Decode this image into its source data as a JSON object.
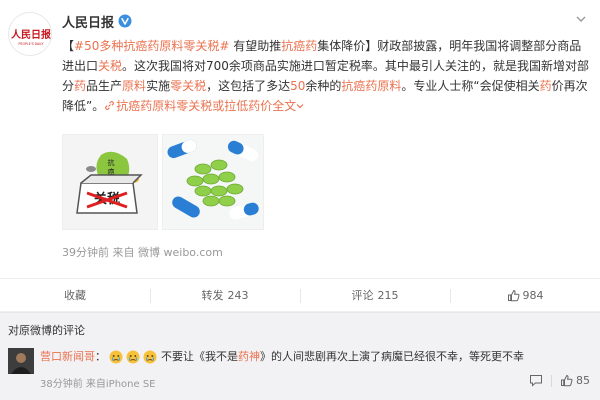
{
  "post": {
    "author": "人民日报",
    "verified_icon": "verified-v-icon",
    "text": {
      "hashtag": "#50多种抗癌药原料零关税#",
      "p1": " 有望助推",
      "h1": "抗癌药",
      "p2": "集体降价",
      "p3": "】财政部披露，明年我国将调整部分商品进出口",
      "h2": "关税",
      "p4": "。这次我国将对700余项商品实施进口暂定税率。其中最引人关注的，就是我国新增对部分",
      "h3": "药",
      "p5": "品生产",
      "h4": "原料",
      "p6": "实施",
      "h5": "零关税",
      "p7": "，这包括了多达",
      "h6": "50",
      "p8": "余种的",
      "h7": "抗癌药原料",
      "p9": "。专业人士称“会促使相关",
      "h8": "药",
      "p10": "价再次降低”。",
      "link_text": "抗癌药原料零关税",
      "link_suffix": "或拉低药价",
      "full_text": "全文"
    },
    "image1": {
      "stamp": "关税",
      "bubble_text_1": "抗",
      "bubble_text_2": "癌"
    },
    "time": "39分钟前",
    "source_prefix": "来自",
    "source": "微博 weibo.com"
  },
  "actions": {
    "collect": "收藏",
    "repost_label": "转发",
    "repost_count": "243",
    "comment_label": "评论",
    "comment_count": "215",
    "like_count": "984"
  },
  "comments_header": "对原微博的评论",
  "comment": {
    "user": "营口新闻哥",
    "text_prefix": "不要让《我不是",
    "text_hl": "药神",
    "text_suffix": "》的人间悲剧再次上演了病魔已经很不幸，等死更不幸",
    "meta": "38分钟前  来自iPhone SE",
    "like_count": "85"
  },
  "colors": {
    "accent": "#eb7350",
    "muted": "#999999",
    "comment_bg": "#f2f2f5"
  }
}
